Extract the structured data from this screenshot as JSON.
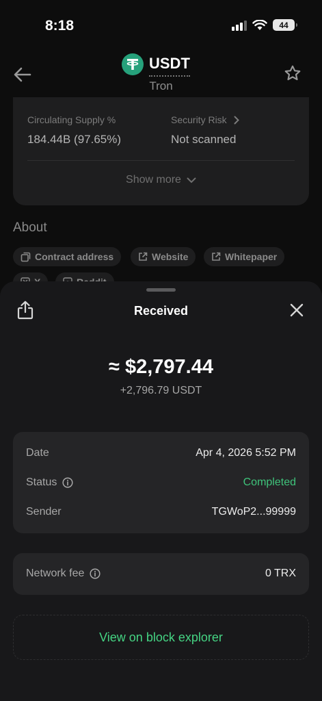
{
  "status_bar": {
    "time": "8:18",
    "battery": "44"
  },
  "header": {
    "symbol": "USDT",
    "network": "Tron"
  },
  "stats": {
    "circulating_label": "Circulating Supply %",
    "circulating_value": "184.44B (97.65%)",
    "security_label": "Security Risk",
    "security_value": "Not scanned",
    "show_more": "Show more"
  },
  "about": {
    "title": "About",
    "chips": [
      "Contract address",
      "Website",
      "Whitepaper",
      "X",
      "Reddit"
    ]
  },
  "sheet": {
    "title": "Received",
    "amount_fiat": "≈ $2,797.44",
    "amount_token": "+2,796.79 USDT",
    "details": {
      "date_label": "Date",
      "date_value": "Apr 4, 2026 5:52 PM",
      "status_label": "Status",
      "status_value": "Completed",
      "sender_label": "Sender",
      "sender_value": "TGWoP2...99999"
    },
    "fee": {
      "label": "Network fee",
      "value": "0 TRX"
    },
    "explorer_label": "View on block explorer"
  },
  "colors": {
    "accent_green": "#45d483",
    "status_green": "#3fc47b",
    "tether_brand": "#26a17b"
  }
}
